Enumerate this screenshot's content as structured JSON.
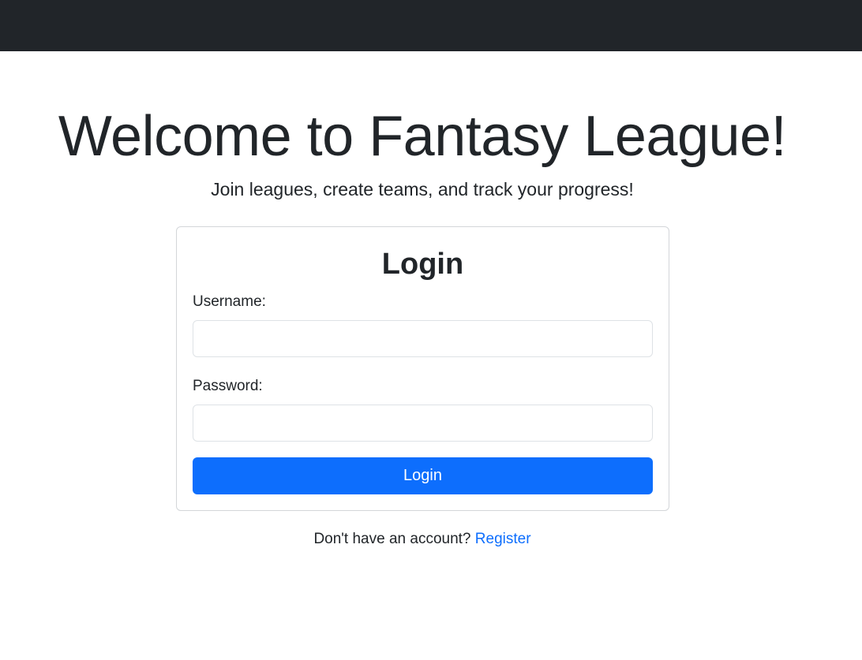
{
  "navbar": {},
  "hero": {
    "title": "Welcome to Fantasy League!",
    "subtitle": "Join leagues, create teams, and track your progress!"
  },
  "login_card": {
    "title": "Login",
    "username_label": "Username:",
    "username_value": "",
    "password_label": "Password:",
    "password_value": "",
    "submit_label": "Login"
  },
  "footer": {
    "prompt": "Don't have an account?",
    "register_link": "Register"
  },
  "colors": {
    "navbar": "#212529",
    "primary": "#0d6efd",
    "text": "#212529",
    "card_border": "#d3d6d9"
  }
}
